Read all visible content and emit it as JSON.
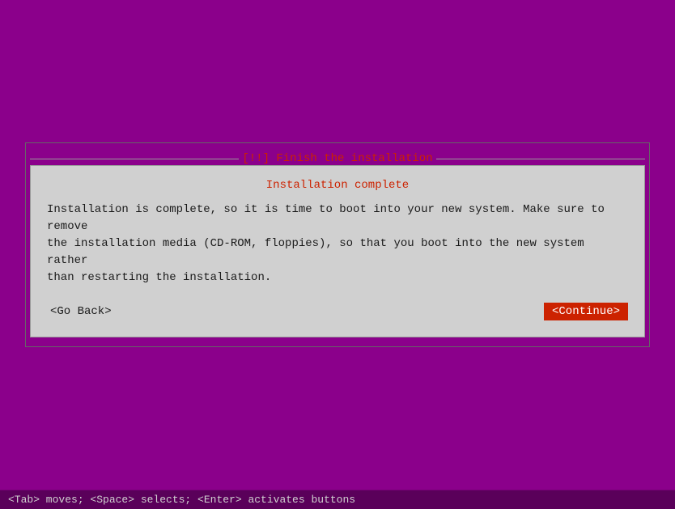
{
  "background_color": "#8B008B",
  "dialog": {
    "title": "[!!] Finish the installation",
    "subtitle": "Installation complete",
    "body": "Installation is complete, so it is time to boot into your new system. Make sure to remove\nthe installation media (CD-ROM, floppies), so that you boot into the new system rather\nthan restarting the installation.",
    "btn_go_back": "<Go Back>",
    "btn_continue": "<Continue>"
  },
  "status_bar": {
    "text": "<Tab> moves; <Space> selects; <Enter> activates buttons"
  }
}
